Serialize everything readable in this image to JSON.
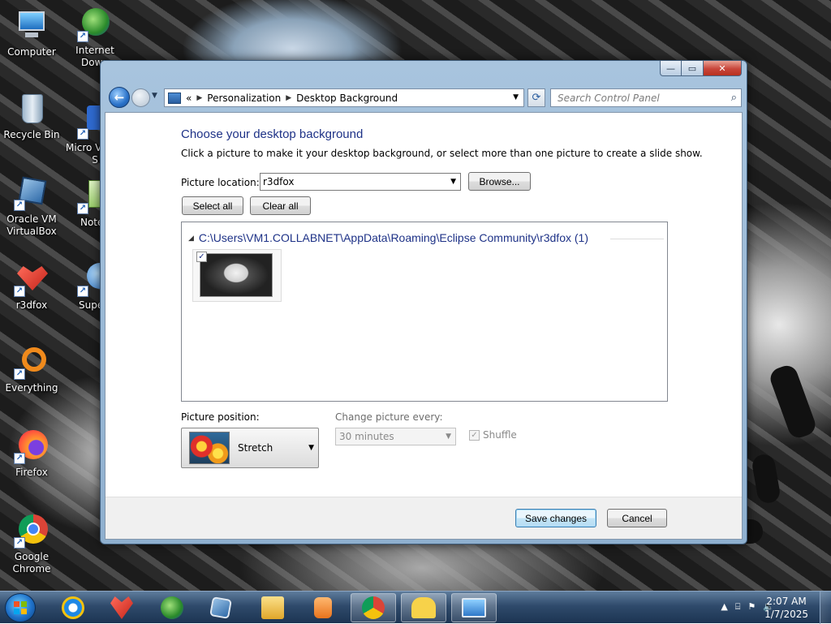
{
  "desktop": {
    "icons_left": [
      {
        "label": "Computer",
        "icon": "computer-icon"
      },
      {
        "label": "Recycle Bin",
        "icon": "recycle-bin-icon"
      },
      {
        "label": "Oracle VM VirtualBox",
        "icon": "virtualbox-icon"
      },
      {
        "label": "r3dfox",
        "icon": "r3dfox-icon"
      },
      {
        "label": "Everything",
        "icon": "everything-icon"
      },
      {
        "label": "Firefox",
        "icon": "firefox-icon"
      },
      {
        "label": "Google Chrome",
        "icon": "chrome-icon"
      }
    ],
    "icons_right": [
      {
        "label": "Internet Down",
        "icon": "internet-download-icon"
      },
      {
        "label": "Micro Visual S",
        "icon": "visual-studio-icon"
      },
      {
        "label": "Notep",
        "icon": "notepad-icon"
      },
      {
        "label": "Superr",
        "icon": "superr-icon"
      }
    ]
  },
  "window": {
    "controls": {
      "minimize": "—",
      "maximize": "▭",
      "close": "✕"
    },
    "address": {
      "overflow": "«",
      "crumbs": [
        "Personalization",
        "Desktop Background"
      ],
      "refresh": "⟳"
    },
    "search": {
      "placeholder": "Search Control Panel"
    },
    "heading": "Choose your desktop background",
    "subtext": "Click a picture to make it your desktop background, or select more than one picture to create a slide show.",
    "picture_location": {
      "label": "Picture location:",
      "value": "r3dfox"
    },
    "browse_label": "Browse...",
    "select_all_label": "Select all",
    "clear_all_label": "Clear all",
    "group": {
      "path": "C:\\Users\\VM1.COLLABNET\\AppData\\Roaming\\Eclipse Community\\r3dfox (1)",
      "thumbnail_checked": true
    },
    "picture_position": {
      "label": "Picture position:",
      "value": "Stretch"
    },
    "change_every": {
      "label": "Change picture every:",
      "value": "30 minutes"
    },
    "shuffle": {
      "label": "Shuffle",
      "checked": true
    },
    "save_label": "Save changes",
    "cancel_label": "Cancel"
  },
  "taskbar": {
    "pinned": [
      "internet-explorer-icon",
      "r3dfox-icon",
      "internet-download-manager-icon",
      "virtualbox-icon",
      "file-explorer-icon",
      "media-player-icon",
      "chrome-icon",
      "sticky-notes-icon",
      "control-panel-icon"
    ],
    "clock": {
      "time": "2:07 AM",
      "date": "1/7/2025"
    }
  },
  "colors": {
    "heading_blue": "#1e3287",
    "taskbar": "#2f4a6b",
    "window_frame": "#a8c4de"
  }
}
